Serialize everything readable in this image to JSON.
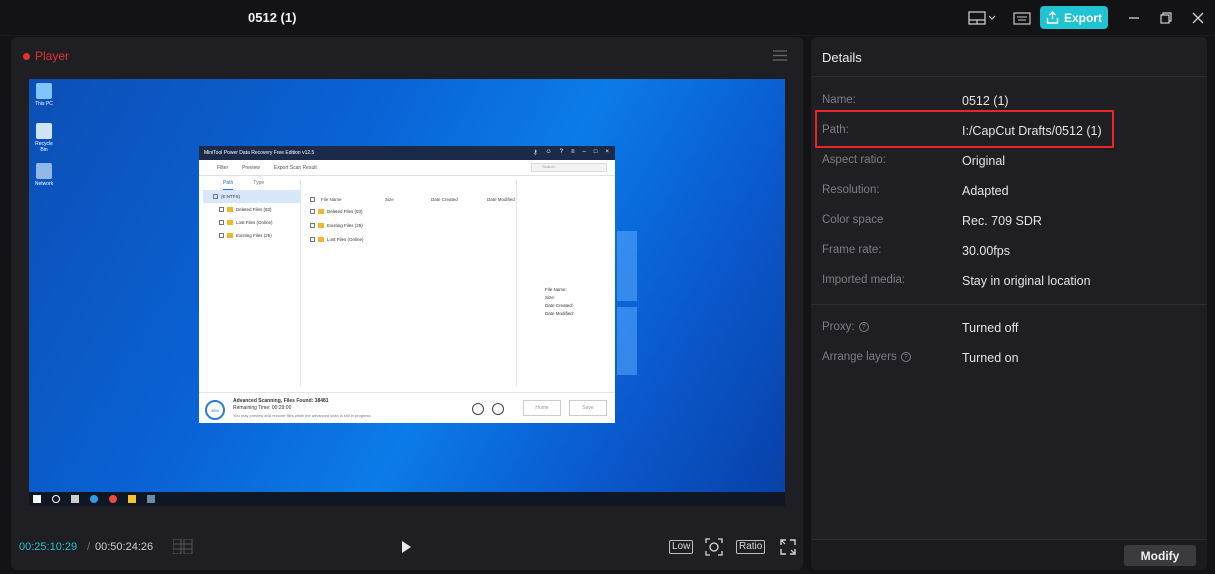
{
  "window": {
    "title": "0512 (1)",
    "export_label": "Export",
    "accent": "#1fc3d1"
  },
  "player": {
    "label": "Player",
    "current_time": "00:25:10:29",
    "separator": "/",
    "total_time": "00:50:24:26",
    "quality_label": "Low",
    "ratio_label": "Ratio"
  },
  "preview": {
    "desktop_icons": [
      "This PC",
      "Recycle Bin",
      "Network"
    ],
    "app": {
      "title": "MiniTool Power Data Recovery Free Edition v12.5",
      "toolbar": [
        "Filter",
        "Preview",
        "Export Scan Result"
      ],
      "search_placeholder": "Search",
      "tabs": [
        "Path",
        "Type"
      ],
      "tree": [
        "(E:NTFS)",
        "Deleted Files (93)",
        "Lost Files (Online)",
        "Existing Files (25)"
      ],
      "columns": [
        "File Name",
        "Size",
        "Date Created",
        "Date Modified"
      ],
      "rows": [
        "Deleted Files (93)",
        "Existing Files (25)",
        "Lost Files (Online)"
      ],
      "props": [
        "File Name:",
        "Size:",
        "Date Created:",
        "Date Modified:"
      ],
      "progress": "38%",
      "status": "Advanced Scanning, Files Found: 38481",
      "remaining": "Remaining Time: 00:29:00",
      "note": "You may preview and recover files while the advanced scan is still in progress.",
      "home_label": "Home",
      "save_label": "Save"
    }
  },
  "details": {
    "heading": "Details",
    "rows": [
      {
        "label": "Name:",
        "value": "0512 (1)"
      },
      {
        "label": "Path:",
        "value": "I:/CapCut Drafts/0512 (1)"
      },
      {
        "label": "Aspect ratio:",
        "value": "Original"
      },
      {
        "label": "Resolution:",
        "value": "Adapted"
      },
      {
        "label": "Color space",
        "value": "Rec. 709 SDR"
      },
      {
        "label": "Frame rate:",
        "value": "30.00fps"
      },
      {
        "label": "Imported media:",
        "value": "Stay in original location"
      },
      {
        "label": "Proxy:",
        "value": "Turned off"
      },
      {
        "label": "Arrange layers",
        "value": "Turned on"
      }
    ],
    "modify_label": "Modify",
    "highlight_color": "#e8262a"
  }
}
